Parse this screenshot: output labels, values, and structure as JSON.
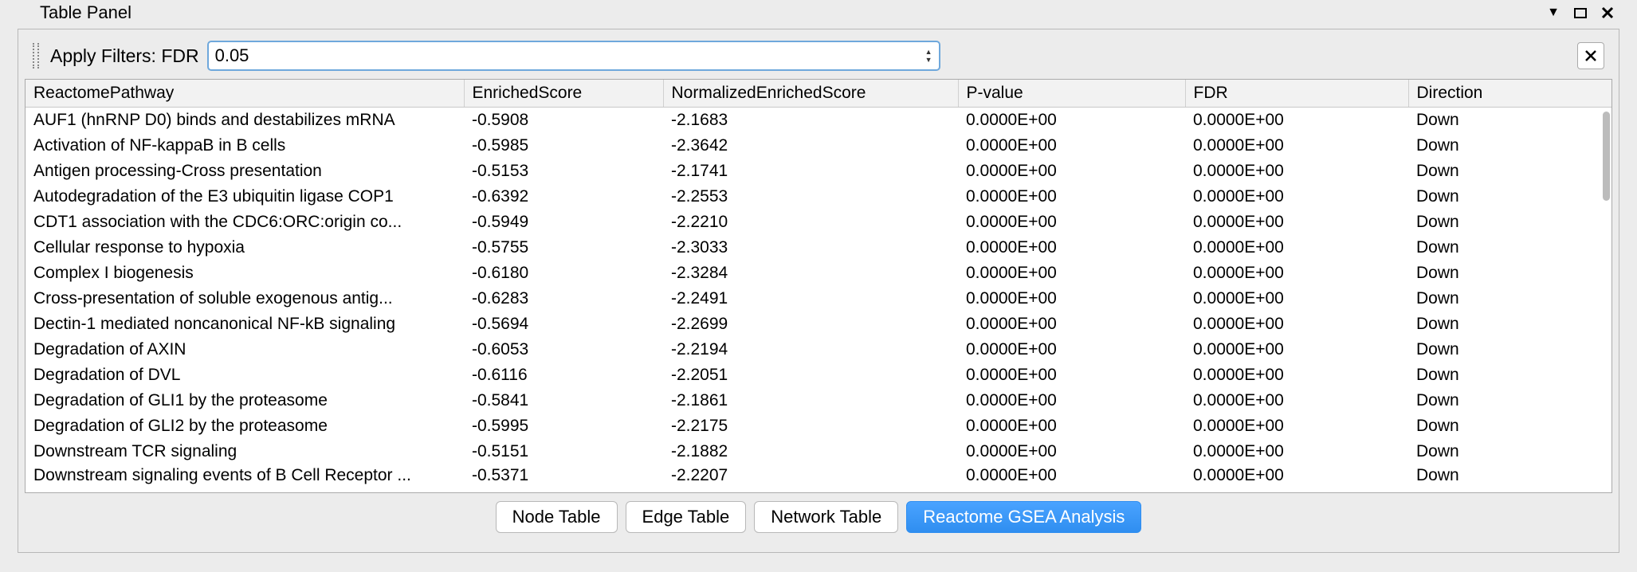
{
  "titlebar": {
    "title": "Table Panel"
  },
  "filter": {
    "label_prefix": "Apply Filters:  FDR",
    "value": "0.05"
  },
  "columns": [
    "ReactomePathway",
    "EnrichedScore",
    "NormalizedEnrichedScore",
    "P-value",
    "FDR",
    "Direction"
  ],
  "rows": [
    {
      "pathway": "AUF1 (hnRNP D0) binds and destabilizes mRNA",
      "es": "-0.5908",
      "nes": "-2.1683",
      "p": "0.0000E+00",
      "fdr": "0.0000E+00",
      "dir": "Down"
    },
    {
      "pathway": "Activation of NF-kappaB in B cells",
      "es": "-0.5985",
      "nes": "-2.3642",
      "p": "0.0000E+00",
      "fdr": "0.0000E+00",
      "dir": "Down"
    },
    {
      "pathway": "Antigen processing-Cross presentation",
      "es": "-0.5153",
      "nes": "-2.1741",
      "p": "0.0000E+00",
      "fdr": "0.0000E+00",
      "dir": "Down"
    },
    {
      "pathway": "Autodegradation of the E3 ubiquitin ligase COP1",
      "es": "-0.6392",
      "nes": "-2.2553",
      "p": "0.0000E+00",
      "fdr": "0.0000E+00",
      "dir": "Down"
    },
    {
      "pathway": "CDT1 association with the CDC6:ORC:origin co...",
      "es": "-0.5949",
      "nes": "-2.2210",
      "p": "0.0000E+00",
      "fdr": "0.0000E+00",
      "dir": "Down"
    },
    {
      "pathway": "Cellular response to hypoxia",
      "es": "-0.5755",
      "nes": "-2.3033",
      "p": "0.0000E+00",
      "fdr": "0.0000E+00",
      "dir": "Down"
    },
    {
      "pathway": "Complex I biogenesis",
      "es": "-0.6180",
      "nes": "-2.3284",
      "p": "0.0000E+00",
      "fdr": "0.0000E+00",
      "dir": "Down"
    },
    {
      "pathway": "Cross-presentation of soluble exogenous antig...",
      "es": "-0.6283",
      "nes": "-2.2491",
      "p": "0.0000E+00",
      "fdr": "0.0000E+00",
      "dir": "Down"
    },
    {
      "pathway": "Dectin-1 mediated noncanonical NF-kB signaling",
      "es": "-0.5694",
      "nes": "-2.2699",
      "p": "0.0000E+00",
      "fdr": "0.0000E+00",
      "dir": "Down"
    },
    {
      "pathway": "Degradation of AXIN",
      "es": "-0.6053",
      "nes": "-2.2194",
      "p": "0.0000E+00",
      "fdr": "0.0000E+00",
      "dir": "Down"
    },
    {
      "pathway": "Degradation of DVL",
      "es": "-0.6116",
      "nes": "-2.2051",
      "p": "0.0000E+00",
      "fdr": "0.0000E+00",
      "dir": "Down"
    },
    {
      "pathway": "Degradation of GLI1 by the proteasome",
      "es": "-0.5841",
      "nes": "-2.1861",
      "p": "0.0000E+00",
      "fdr": "0.0000E+00",
      "dir": "Down"
    },
    {
      "pathway": "Degradation of GLI2 by the proteasome",
      "es": "-0.5995",
      "nes": "-2.2175",
      "p": "0.0000E+00",
      "fdr": "0.0000E+00",
      "dir": "Down"
    },
    {
      "pathway": "Downstream TCR signaling",
      "es": "-0.5151",
      "nes": "-2.1882",
      "p": "0.0000E+00",
      "fdr": "0.0000E+00",
      "dir": "Down"
    },
    {
      "pathway": "Downstream signaling events of B Cell Receptor ...",
      "es": "-0.5371",
      "nes": "-2.2207",
      "p": "0.0000E+00",
      "fdr": "0.0000E+00",
      "dir": "Down"
    }
  ],
  "tabs": [
    {
      "id": "node",
      "label": "Node Table",
      "active": false
    },
    {
      "id": "edge",
      "label": "Edge Table",
      "active": false
    },
    {
      "id": "network",
      "label": "Network Table",
      "active": false
    },
    {
      "id": "gsea",
      "label": "Reactome GSEA Analysis",
      "active": true
    }
  ]
}
